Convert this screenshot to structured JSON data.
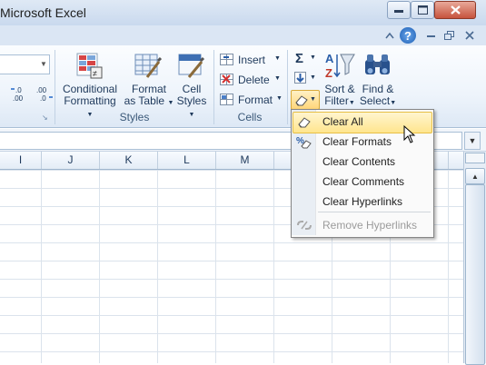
{
  "window": {
    "title": "Microsoft Excel"
  },
  "ribbon": {
    "number_group": {
      "inc_decimal": ".0\n.00",
      "dec_decimal": ".00\n.0"
    },
    "styles_group": {
      "label": "Styles",
      "conditional_formatting": [
        "Conditional",
        "Formatting"
      ],
      "format_as_table": [
        "Format",
        "as Table"
      ],
      "cell_styles": [
        "Cell",
        "Styles"
      ]
    },
    "cells_group": {
      "label": "Cells",
      "insert": "Insert",
      "delete": "Delete",
      "format": "Format"
    },
    "editing_group": {
      "autosum_symbol": "Σ",
      "sort_filter": [
        "Sort &",
        "Filter"
      ],
      "find_select": [
        "Find &",
        "Select"
      ]
    }
  },
  "help": {
    "help_glyph": "?"
  },
  "grid": {
    "columns": [
      "I",
      "J",
      "K",
      "L",
      "M"
    ]
  },
  "menu": {
    "items": [
      {
        "label": "Clear All",
        "icon": "eraser-icon",
        "enabled": true,
        "highlighted": true
      },
      {
        "label": "Clear Formats",
        "icon": "percent-eraser-icon",
        "enabled": true
      },
      {
        "label": "Clear Contents",
        "icon": "",
        "enabled": true
      },
      {
        "label": "Clear Comments",
        "icon": "",
        "enabled": true
      },
      {
        "label": "Clear Hyperlinks",
        "icon": "",
        "enabled": true
      },
      {
        "label": "Remove Hyperlinks",
        "icon": "unlink-icon",
        "enabled": false
      }
    ]
  },
  "colors": {
    "accent": "#1e395b",
    "highlight": "#ffe58d",
    "disabled_text": "#9b9b9b"
  }
}
